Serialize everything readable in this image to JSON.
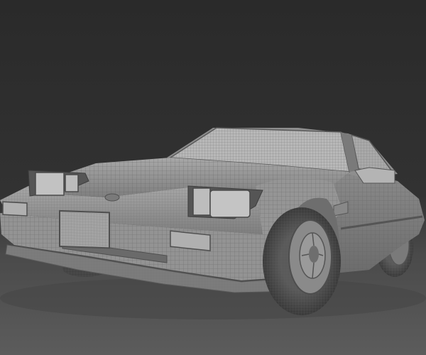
{
  "scene": {
    "subject": "sports-coupe-3d-model",
    "render_style": "wireframe-on-shaded",
    "colors": {
      "background_top": "#2b2b2b",
      "background_bottom": "#5a5a5a",
      "body": "#9a9a9a",
      "wire": "#5c5c5c",
      "glass": "#c4c4c4",
      "tire": "#4a4a4a"
    }
  }
}
